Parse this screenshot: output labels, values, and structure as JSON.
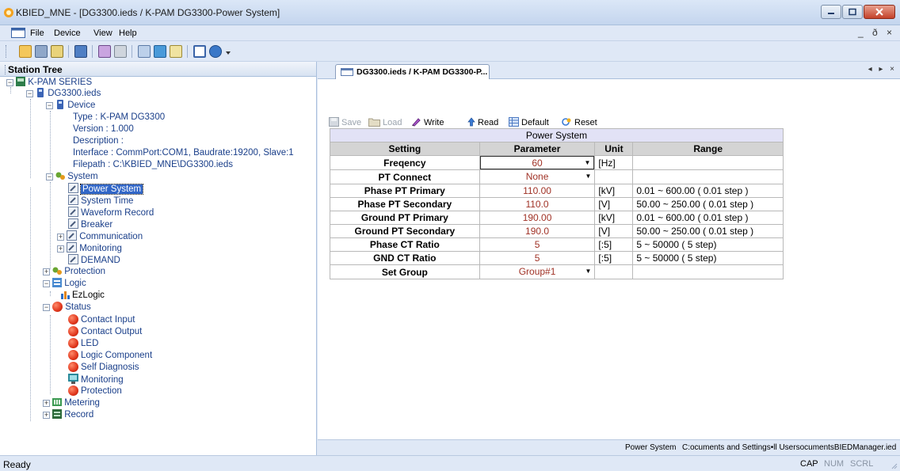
{
  "window": {
    "title": "KBIED_MNE - [DG3300.ieds / K-PAM DG3300-Power System]"
  },
  "menu": {
    "items": [
      "File",
      "Device",
      "View",
      "Help"
    ],
    "mdi_controls": "_ ð ×"
  },
  "station_tree": {
    "header": "Station Tree",
    "nodes": {
      "root": "K-PAM SERIES",
      "file": "DG3300.ieds",
      "device": "Device",
      "type": "Type : K-PAM DG3300",
      "version": "Version : 1.000",
      "description": "Description :",
      "interface": "Interface : CommPort:COM1, Baudrate:19200, Slave:1",
      "filepath": "Filepath : C:\\KBIED_MNE\\DG3300.ieds",
      "system": "System",
      "power_system": "Power System",
      "system_time": "System Time",
      "waveform_record": "Waveform Record",
      "breaker": "Breaker",
      "communication": "Communication",
      "monitoring": "Monitoring",
      "demand": "DEMAND",
      "protection": "Protection",
      "logic": "Logic",
      "ezlogic": "EzLogic",
      "status": "Status",
      "contact_input": "Contact Input",
      "contact_output": "Contact Output",
      "led": "LED",
      "logic_component": "Logic Component",
      "self_diagnosis": "Self Diagnosis",
      "status_monitoring": "Monitoring",
      "status_protection": "Protection",
      "metering": "Metering",
      "record": "Record"
    }
  },
  "document": {
    "tab_label": "DG3300.ieds / K-PAM DG3300-P...",
    "tab_nav": "◂ ▸ ×",
    "toolbar": {
      "save": "Save",
      "load": "Load",
      "write": "Write",
      "read": "Read",
      "default": "Default",
      "reset": "Reset"
    },
    "table": {
      "caption": "Power System",
      "headers": {
        "setting": "Setting",
        "parameter": "Parameter",
        "unit": "Unit",
        "range": "Range"
      },
      "rows": [
        {
          "setting": "Freqency",
          "parameter": "60",
          "unit": "[Hz]",
          "range": ""
        },
        {
          "setting": "PT Connect",
          "parameter": "None",
          "unit": "",
          "range": ""
        },
        {
          "setting": "Phase PT Primary",
          "parameter": "110.00",
          "unit": "[kV]",
          "range": "0.01 ~ 600.00 ( 0.01 step )"
        },
        {
          "setting": "Phase PT Secondary",
          "parameter": "110.0",
          "unit": "[V]",
          "range": "50.00 ~ 250.00 ( 0.01 step )"
        },
        {
          "setting": "Ground PT Primary",
          "parameter": "190.00",
          "unit": "[kV]",
          "range": "0.01 ~ 600.00 ( 0.01 step )"
        },
        {
          "setting": "Ground PT Secondary",
          "parameter": "190.0",
          "unit": "[V]",
          "range": "50.00 ~ 250.00 ( 0.01 step )"
        },
        {
          "setting": "Phase CT Ratio",
          "parameter": "5",
          "unit": "[:5]",
          "range": "5 ~ 50000 ( 5 step)"
        },
        {
          "setting": "GND CT Ratio",
          "parameter": "5",
          "unit": "[:5]",
          "range": "5 ~ 50000 ( 5 step)"
        },
        {
          "setting": "Set Group",
          "parameter": "Group#1",
          "unit": "",
          "range": ""
        }
      ]
    },
    "status_left": "Power System",
    "status_path": "C:ocuments and Settings•ll UsersocumentsBIEDManager.ied"
  },
  "statusbar": {
    "ready": "Ready",
    "cap": "CAP",
    "num": "NUM",
    "scrl": "SCRL"
  },
  "colors": {
    "param_text": "#a03226",
    "selection": "#3166c7",
    "chrome_bg": "#dfe8f6"
  }
}
